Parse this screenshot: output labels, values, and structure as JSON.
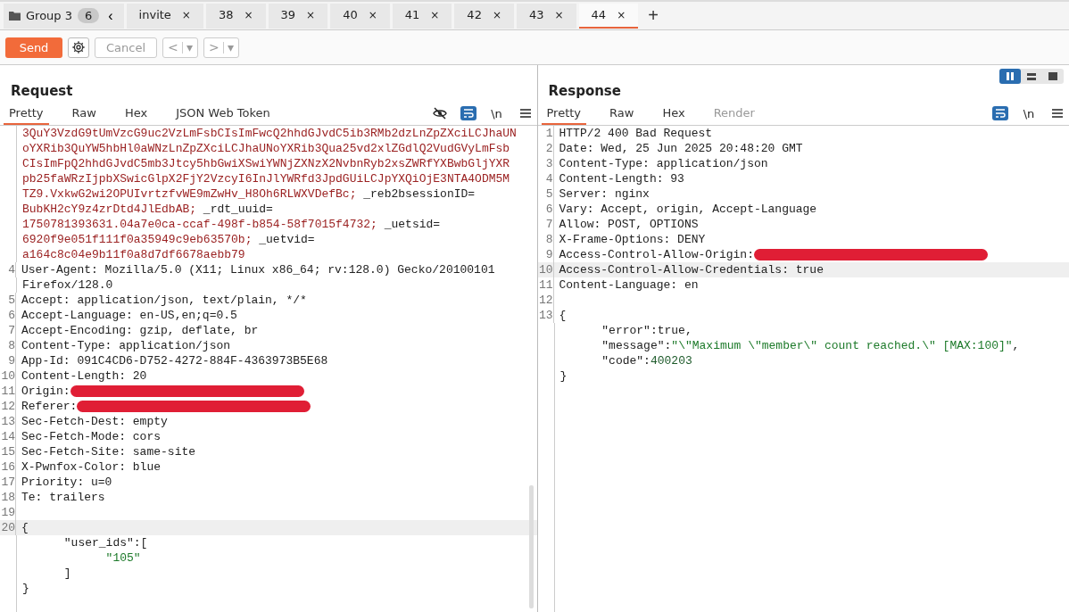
{
  "group": {
    "label": "Group 3",
    "count": "6",
    "collapse": "‹"
  },
  "tabs": [
    {
      "label": "invite",
      "close": "×",
      "selected": false
    },
    {
      "label": "38",
      "close": "×",
      "selected": false
    },
    {
      "label": "39",
      "close": "×",
      "selected": false
    },
    {
      "label": "40",
      "close": "×",
      "selected": false
    },
    {
      "label": "41",
      "close": "×",
      "selected": false
    },
    {
      "label": "42",
      "close": "×",
      "selected": false
    },
    {
      "label": "43",
      "close": "×",
      "selected": false
    },
    {
      "label": "44",
      "close": "×",
      "selected": true
    }
  ],
  "new_tab": "+",
  "toolbar": {
    "send": "Send",
    "cancel": "Cancel",
    "back": "<",
    "forward": ">",
    "dropdown": "▾"
  },
  "layout_toggle": [
    {
      "kind": "columns",
      "selected": true
    },
    {
      "kind": "rows",
      "selected": false
    },
    {
      "kind": "single",
      "selected": false
    }
  ],
  "request": {
    "title": "Request",
    "tabs": [
      {
        "label": "Pretty",
        "selected": true,
        "disabled": false
      },
      {
        "label": "Raw",
        "selected": false,
        "disabled": false
      },
      {
        "label": "Hex",
        "selected": false,
        "disabled": false
      },
      {
        "label": "JSON Web Token",
        "selected": false,
        "disabled": false
      }
    ],
    "tools": [
      {
        "kind": "hide"
      },
      {
        "kind": "wrap",
        "on": true
      },
      {
        "kind": "newline",
        "label": "\\n"
      },
      {
        "kind": "menu"
      }
    ],
    "lines": [
      {
        "parts": [
          {
            "text": "3QuY3VzdG9tUmVzcG9uc2VzLmFsbCIsImFwcQ2hhdGJvdC5ib3RMb2dzLnZpZXciLCJhaUN",
            "kind": "cookie"
          }
        ]
      },
      {
        "parts": [
          {
            "text": "oYXRib3QuYW5hbHl0aWNzLnZpZXciLCJhaUNoYXRib3Qua25vd2xlZGdlQ2VudGVyLmFsb",
            "kind": "cookie"
          }
        ]
      },
      {
        "parts": [
          {
            "text": "CIsImFpQ2hhdGJvdC5mb3Jtcy5hbGwiXSwiYWNjZXNzX2NvbnRyb2xsZWRfYXBwbGljYXR",
            "kind": "cookie"
          }
        ]
      },
      {
        "parts": [
          {
            "text": "pb25faWRzIjpbXSwicGlpX2FjY2VzcyI6InJlYWRfd3JpdGUiLCJpYXQiOjE3NTA4ODM5M",
            "kind": "cookie"
          }
        ]
      },
      {
        "parts": [
          {
            "text": "TZ9.VxkwG2wi2OPUIvrtzfvWE9mZwHv_H8Oh6RLWXVDefBc;",
            "kind": "cookie"
          },
          {
            "text": " _reb2bsessionID=",
            "kind": "plain"
          }
        ]
      },
      {
        "parts": [
          {
            "text": "BubKH2cY9z4zrDtd4JlEdbAB;",
            "kind": "cookie"
          },
          {
            "text": " _rdt_uuid=",
            "kind": "plain"
          }
        ]
      },
      {
        "parts": [
          {
            "text": "1750781393631.04a7e0ca-ccaf-498f-b854-58f7015f4732;",
            "kind": "cookie"
          },
          {
            "text": " _uetsid=",
            "kind": "plain"
          }
        ]
      },
      {
        "parts": [
          {
            "text": "6920f9e051f111f0a35949c9eb63570b;",
            "kind": "cookie"
          },
          {
            "text": " _uetvid=",
            "kind": "plain"
          }
        ]
      },
      {
        "parts": [
          {
            "text": "a164c8c04e9b11f0a8d7df6678aebb79",
            "kind": "cookie"
          }
        ]
      },
      {
        "num": "4",
        "parts": [
          {
            "text": "User-Agent: Mozilla/5.0 (X11; Linux x86_64; rv:128.0) Gecko/20100101",
            "kind": "plain"
          }
        ]
      },
      {
        "parts": [
          {
            "text": "Firefox/128.0",
            "kind": "plain"
          }
        ]
      },
      {
        "num": "5",
        "parts": [
          {
            "text": "Accept: application/json, text/plain, */*",
            "kind": "plain"
          }
        ]
      },
      {
        "num": "6",
        "parts": [
          {
            "text": "Accept-Language: en-US,en;q=0.5",
            "kind": "plain"
          }
        ]
      },
      {
        "num": "7",
        "parts": [
          {
            "text": "Accept-Encoding: gzip, deflate, br",
            "kind": "plain"
          }
        ]
      },
      {
        "num": "8",
        "parts": [
          {
            "text": "Content-Type: application/json",
            "kind": "plain"
          }
        ]
      },
      {
        "num": "9",
        "parts": [
          {
            "text": "App-Id: 091C4CD6-D752-4272-884F-4363973B5E68",
            "kind": "plain"
          }
        ]
      },
      {
        "num": "10",
        "parts": [
          {
            "text": "Content-Length: 20",
            "kind": "plain"
          }
        ]
      },
      {
        "num": "11",
        "parts": [
          {
            "text": "Origin:",
            "kind": "plain"
          }
        ],
        "redacted": true
      },
      {
        "num": "12",
        "parts": [
          {
            "text": "Referer:",
            "kind": "plain"
          }
        ],
        "redacted": true
      },
      {
        "num": "13",
        "parts": [
          {
            "text": "Sec-Fetch-Dest: empty",
            "kind": "plain"
          }
        ]
      },
      {
        "num": "14",
        "parts": [
          {
            "text": "Sec-Fetch-Mode: cors",
            "kind": "plain"
          }
        ]
      },
      {
        "num": "15",
        "parts": [
          {
            "text": "Sec-Fetch-Site: same-site",
            "kind": "plain"
          }
        ]
      },
      {
        "num": "16",
        "parts": [
          {
            "text": "X-Pwnfox-Color: blue",
            "kind": "plain"
          }
        ]
      },
      {
        "num": "17",
        "parts": [
          {
            "text": "Priority: u=0",
            "kind": "plain"
          }
        ]
      },
      {
        "num": "18",
        "parts": [
          {
            "text": "Te: trailers",
            "kind": "plain"
          }
        ]
      },
      {
        "num": "19"
      },
      {
        "num": "20",
        "parts": [
          {
            "text": "{",
            "kind": "plain"
          }
        ],
        "highlighted": true
      },
      {
        "parts": [
          {
            "text": "      \"user_ids\":[",
            "kind": "plain"
          }
        ]
      },
      {
        "parts": [
          {
            "text": "            \"105\"",
            "kind": "string"
          }
        ]
      },
      {
        "parts": [
          {
            "text": "      ]",
            "kind": "plain"
          }
        ]
      },
      {
        "parts": [
          {
            "text": "}",
            "kind": "plain"
          }
        ]
      }
    ]
  },
  "response": {
    "title": "Response",
    "tabs": [
      {
        "label": "Pretty",
        "selected": true,
        "disabled": false
      },
      {
        "label": "Raw",
        "selected": false,
        "disabled": false
      },
      {
        "label": "Hex",
        "selected": false,
        "disabled": false
      },
      {
        "label": "Render",
        "selected": false,
        "disabled": true
      }
    ],
    "tools": [
      {
        "kind": "wrap",
        "on": true
      },
      {
        "kind": "newline",
        "label": "\\n"
      },
      {
        "kind": "menu"
      }
    ],
    "lines": [
      {
        "num": "1",
        "parts": [
          {
            "text": "HTTP/2 400 Bad Request",
            "kind": "plain"
          }
        ]
      },
      {
        "num": "2",
        "parts": [
          {
            "text": "Date: Wed, 25 Jun 2025 20:48:20 GMT",
            "kind": "plain"
          }
        ]
      },
      {
        "num": "3",
        "parts": [
          {
            "text": "Content-Type: application/json",
            "kind": "plain"
          }
        ]
      },
      {
        "num": "4",
        "parts": [
          {
            "text": "Content-Length: 93",
            "kind": "plain"
          }
        ]
      },
      {
        "num": "5",
        "parts": [
          {
            "text": "Server: nginx",
            "kind": "plain"
          }
        ]
      },
      {
        "num": "6",
        "parts": [
          {
            "text": "Vary: Accept, origin, Accept-Language",
            "kind": "plain"
          }
        ]
      },
      {
        "num": "7",
        "parts": [
          {
            "text": "Allow: POST, OPTIONS",
            "kind": "plain"
          }
        ]
      },
      {
        "num": "8",
        "parts": [
          {
            "text": "X-Frame-Options: DENY",
            "kind": "plain"
          }
        ]
      },
      {
        "num": "9",
        "parts": [
          {
            "text": "Access-Control-Allow-Origin:",
            "kind": "plain"
          }
        ],
        "redacted": true
      },
      {
        "num": "10",
        "parts": [
          {
            "text": "Access-Control-Allow-Credentials: true",
            "kind": "plain"
          }
        ],
        "highlighted": true
      },
      {
        "num": "11",
        "parts": [
          {
            "text": "Content-Language: en",
            "kind": "plain"
          }
        ]
      },
      {
        "num": "12"
      },
      {
        "num": "13",
        "parts": [
          {
            "text": "{",
            "kind": "plain"
          }
        ]
      },
      {
        "parts": [
          {
            "text": "      \"error\":true,",
            "kind": "plain"
          }
        ]
      },
      {
        "parts": [
          {
            "text": "      \"message\":",
            "kind": "plain"
          },
          {
            "text": "\"\\\"Maximum \\\"member\\\" count reached.\\\" [MAX:100]\"",
            "kind": "string"
          },
          {
            "text": ",",
            "kind": "plain"
          }
        ]
      },
      {
        "parts": [
          {
            "text": "      \"code\":",
            "kind": "plain"
          },
          {
            "text": "400203",
            "kind": "number"
          }
        ]
      },
      {
        "parts": [
          {
            "text": "}",
            "kind": "plain"
          }
        ]
      }
    ]
  }
}
